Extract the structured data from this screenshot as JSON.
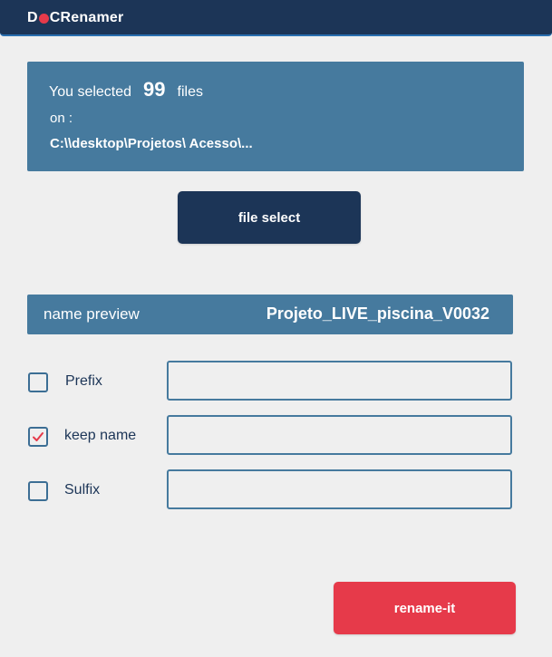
{
  "app": {
    "logo_prefix": "D",
    "logo_suffix": "CRenamer"
  },
  "selection": {
    "prefix_text": "You selected",
    "count": "99",
    "suffix_text": "files",
    "on_label": "on :",
    "path": "C:\\\\desktop\\Projetos\\ Acesso\\..."
  },
  "buttons": {
    "file_select": "file select",
    "rename": "rename-it"
  },
  "preview": {
    "label": "name preview",
    "value": "Projeto_LIVE_piscina_V0032"
  },
  "options": [
    {
      "label": "Prefix",
      "checked": false,
      "input_value": ""
    },
    {
      "label": "keep name",
      "checked": true,
      "input_value": ""
    },
    {
      "label": "Sulfix",
      "checked": false,
      "input_value": ""
    }
  ],
  "colors": {
    "navy": "#1c3557",
    "steel_blue": "#467a9e",
    "accent_red": "#e63a4a",
    "background": "#efefef"
  }
}
